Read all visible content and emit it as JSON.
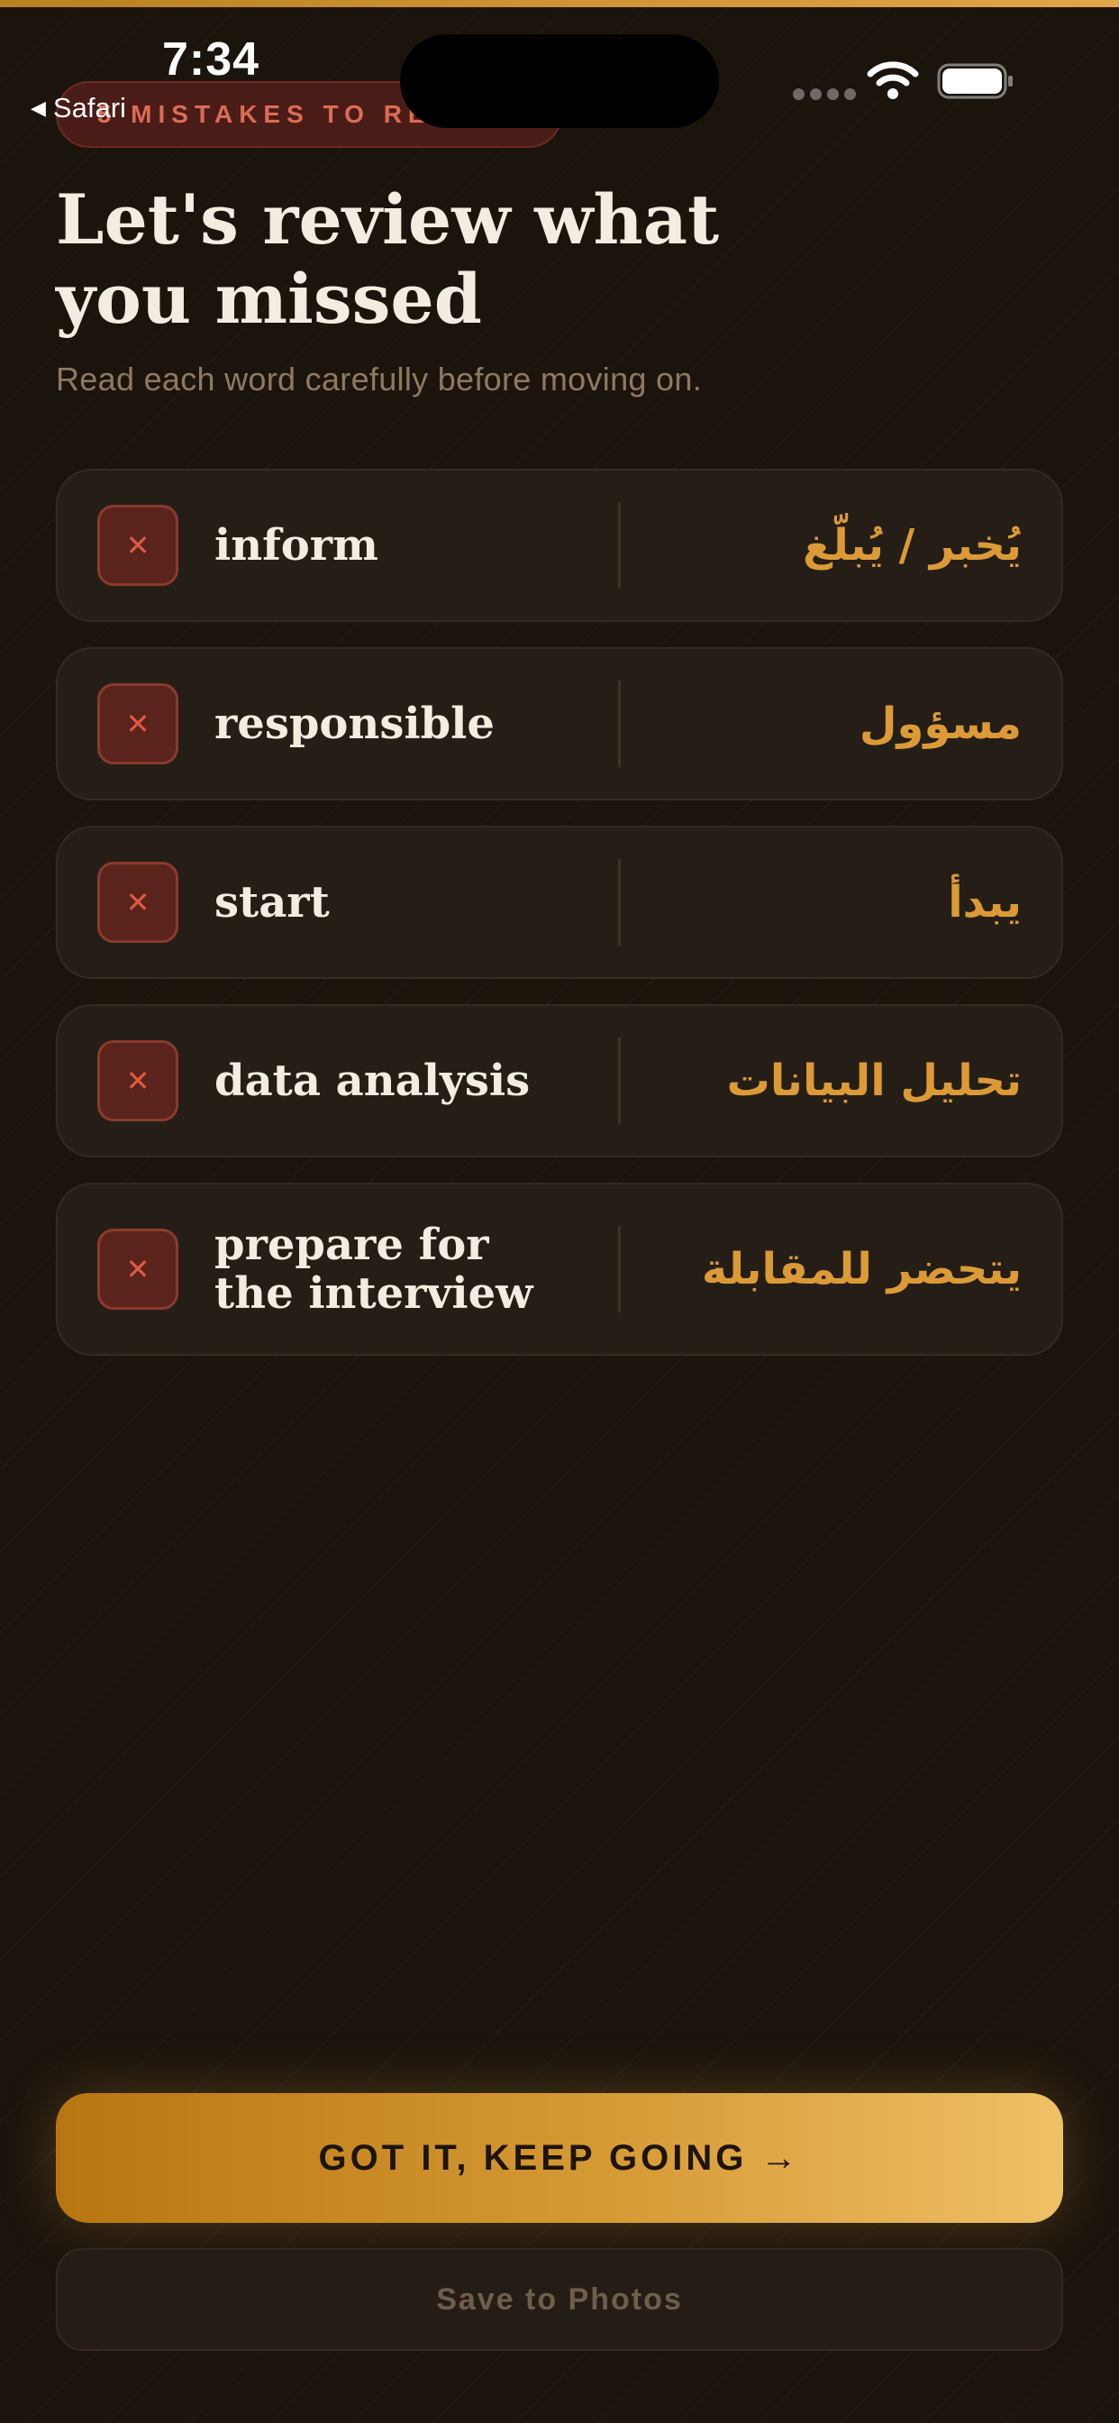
{
  "status_bar": {
    "time": "7:34",
    "back_app": "Safari",
    "back_icon": "back-triangle-icon",
    "wifi_icon": "wifi-icon",
    "battery_icon": "battery-icon"
  },
  "pill": {
    "label": "5 MISTAKES TO REVIEW"
  },
  "header": {
    "title": "Let's review what you missed",
    "subtitle": "Read each word carefully before moving on."
  },
  "words": [
    {
      "english": "inform",
      "arabic": "يُخبر / يُبلّغ",
      "icon": "close-icon"
    },
    {
      "english": "responsible",
      "arabic": "مسؤول",
      "icon": "close-icon"
    },
    {
      "english": "start",
      "arabic": "يبدأ",
      "icon": "close-icon"
    },
    {
      "english": "data analysis",
      "arabic": "تحليل البيانات",
      "icon": "close-icon"
    },
    {
      "english": "prepare for the interview",
      "arabic": "يتحضر للمقابلة",
      "icon": "close-icon"
    }
  ],
  "actions": {
    "primary_label": "GOT IT, KEEP GOING →",
    "secondary_label": "Save to Photos"
  },
  "colors": {
    "background": "#1b140d",
    "accent": "#dc9a37",
    "error": "#e05a45",
    "text": "#f4ece0"
  }
}
